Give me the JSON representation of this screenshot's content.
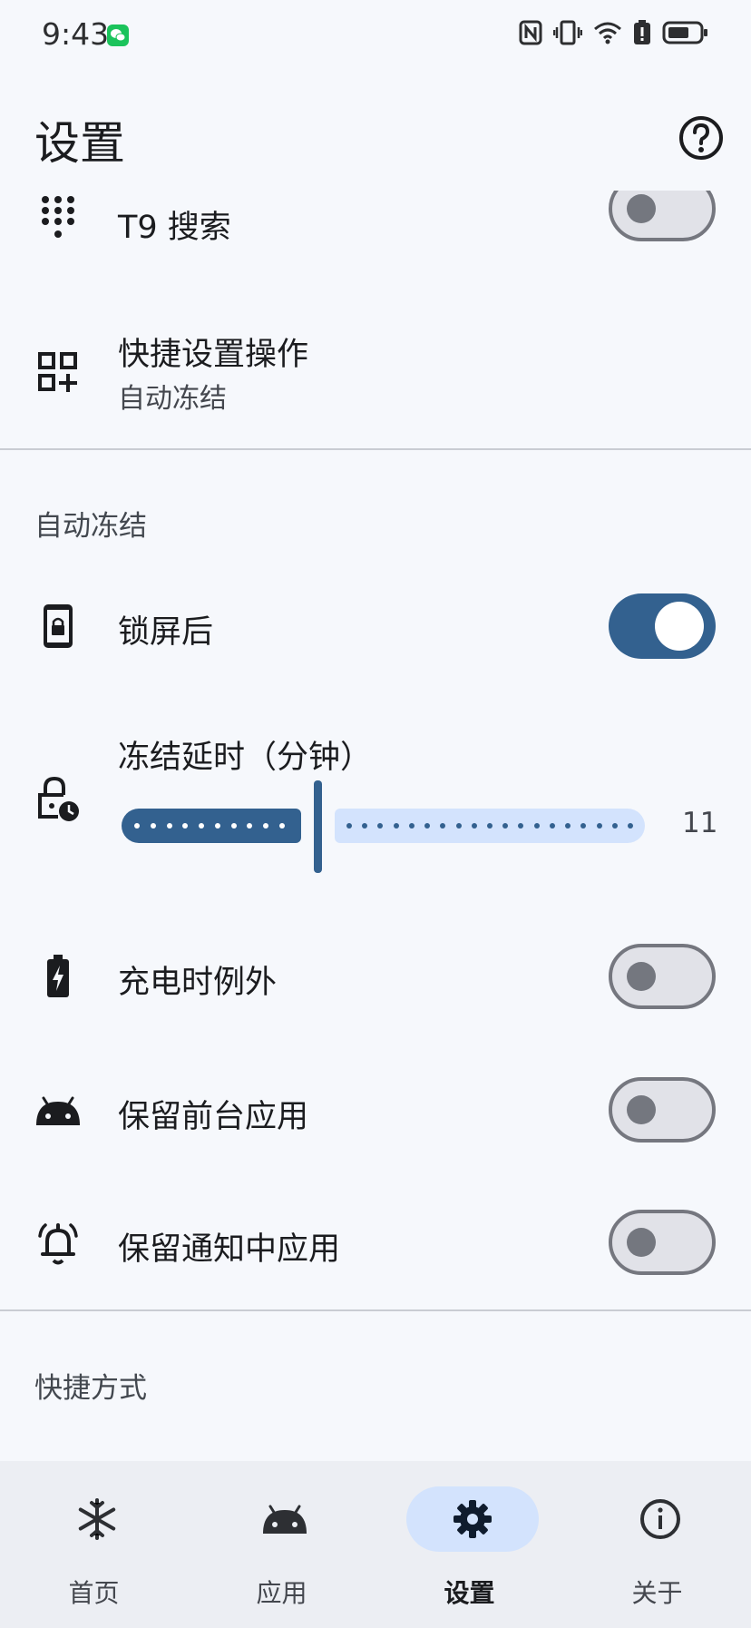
{
  "status_bar": {
    "time": "9:43",
    "notification_icon": "wechat-icon",
    "icons": [
      "nfc-icon",
      "vibrate-icon",
      "wifi-icon",
      "battery-alert-icon",
      "battery-icon"
    ]
  },
  "header": {
    "title": "设置",
    "help_icon": "help-circle-icon"
  },
  "general": {
    "t9_search": {
      "label": "T9 搜索",
      "icon": "dialpad-icon",
      "enabled": false
    },
    "quick_settings": {
      "label": "快捷设置操作",
      "sub": "自动冻结",
      "icon": "qr-add-icon"
    }
  },
  "auto_freeze": {
    "section_title": "自动冻结",
    "after_lock": {
      "label": "锁屏后",
      "icon": "lock-phone-icon",
      "enabled": true
    },
    "delay": {
      "label": "冻结延时（分钟）",
      "icon": "lock-clock-icon",
      "value": "11"
    },
    "charging_exception": {
      "label": "充电时例外",
      "icon": "battery-charging-icon",
      "enabled": false
    },
    "keep_foreground": {
      "label": "保留前台应用",
      "icon": "android-icon",
      "enabled": false
    },
    "keep_notification": {
      "label": "保留通知中应用",
      "icon": "bell-icon",
      "enabled": false
    }
  },
  "shortcuts": {
    "section_title": "快捷方式"
  },
  "nav": {
    "items": [
      {
        "label": "首页",
        "icon": "snowflake-icon",
        "active": false
      },
      {
        "label": "应用",
        "icon": "android-icon",
        "active": false
      },
      {
        "label": "设置",
        "icon": "gear-icon",
        "active": true
      },
      {
        "label": "关于",
        "icon": "info-icon",
        "active": false
      }
    ]
  },
  "colors": {
    "primary": "#33618f",
    "track_inactive": "#d3e3fd",
    "background": "#f6f8fc",
    "nav_background": "#eceef3"
  }
}
